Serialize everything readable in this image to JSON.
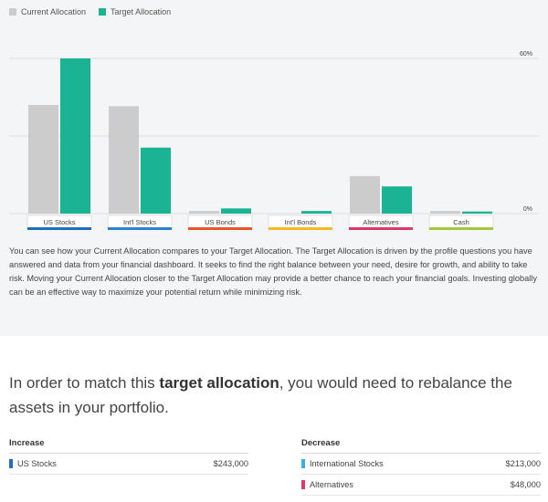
{
  "legend": {
    "current": {
      "label": "Current Allocation",
      "color": "#cccccc"
    },
    "target": {
      "label": "Target Allocation",
      "color": "#1ab394"
    }
  },
  "chart_data": {
    "type": "bar",
    "categories": [
      "US Stocks",
      "Int'l Stocks",
      "US Bonds",
      "Int'l Bonds",
      "Alternatives",
      "Cash"
    ],
    "category_colors": [
      "#1f6fbf",
      "#2b82d0",
      "#e8552a",
      "#f2b72a",
      "#d83a6a",
      "#a3c93a"
    ],
    "series": [
      {
        "name": "Current Allocation",
        "color": "#cccccc",
        "values": [
          42,
          41.5,
          1,
          0,
          14.5,
          1
        ]
      },
      {
        "name": "Target Allocation",
        "color": "#1ab394",
        "values": [
          60,
          25.5,
          2,
          1,
          10.5,
          0.8
        ]
      }
    ],
    "ylim": [
      0,
      60
    ],
    "ytick_labels": {
      "top": "60%",
      "bottom": "0%"
    },
    "grid": true,
    "legend_position": "top-left"
  },
  "description": "You can see how your Current Allocation compares to your Target Allocation. The Target Allocation is driven by the profile questions you have answered and data from your financial dashboard. It seeks to find the right balance between your need, desire for growth, and ability to take risk. Moving your Current Allocation closer to the Target Allocation may provide a better chance to reach your financial goals. Investing globally can be an effective way to maximize your potential return while minimizing risk.",
  "headline": {
    "before": "In order to match this ",
    "emphasis": "target allocation",
    "after": ", you would need to rebalance the assets in your portfolio."
  },
  "increase": {
    "title": "Increase",
    "items": [
      {
        "label": "US Stocks",
        "amount": "$243,000",
        "color": "#1f6fbf"
      }
    ]
  },
  "decrease": {
    "title": "Decrease",
    "items": [
      {
        "label": "International Stocks",
        "amount": "$213,000",
        "color": "#3ab0e0"
      },
      {
        "label": "Alternatives",
        "amount": "$48,000",
        "color": "#d83a6a"
      }
    ]
  }
}
